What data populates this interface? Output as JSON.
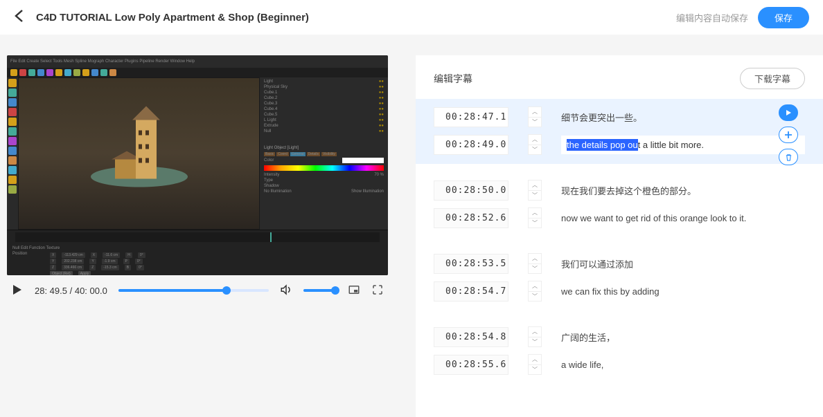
{
  "header": {
    "title": "C4D TUTORIAL Low Poly Apartment & Shop (Beginner)",
    "auto_save": "编辑内容自动保存",
    "save": "保存"
  },
  "player": {
    "current_time": "28: 49.5",
    "duration": "40: 00.0",
    "progress_pct": 71.9,
    "volume_pct": 100
  },
  "subtitle_panel": {
    "title": "编辑字幕",
    "download": "下载字幕"
  },
  "subtitles": [
    {
      "active": true,
      "rows": [
        {
          "ts": "00:28:47.1",
          "text": "细节会更突出一些。",
          "editing": false
        },
        {
          "ts": "00:28:49.0",
          "text_highlight": "the details pop ou",
          "text_rest": "t a little bit more.",
          "editing": true
        }
      ],
      "actions": {
        "play": "play",
        "add": "plus",
        "delete": "trash"
      }
    },
    {
      "active": false,
      "rows": [
        {
          "ts": "00:28:50.0",
          "text": "现在我们要去掉这个橙色的部分。"
        },
        {
          "ts": "00:28:52.6",
          "text": "now we want to get rid of this orange look to it."
        }
      ]
    },
    {
      "active": false,
      "rows": [
        {
          "ts": "00:28:53.5",
          "text": "我们可以通过添加"
        },
        {
          "ts": "00:28:54.7",
          "text": "we can fix this by adding"
        }
      ]
    },
    {
      "active": false,
      "rows": [
        {
          "ts": "00:28:54.8",
          "text": "广阔的生活，"
        },
        {
          "ts": "00:28:55.6",
          "text": "a wide life,"
        }
      ]
    }
  ],
  "c4d": {
    "menu": "File Edit Create Select Tools Mesh Spline Mograph Character Plugins Pipeline Render Window Help",
    "scene_items": [
      "Light",
      "Physical Sky",
      "Cube.1",
      "Cube.2",
      "Cube.3",
      "Cube.4",
      "Cube.5",
      "L Light",
      "Extrude",
      "Null",
      "Null"
    ],
    "attr_tabs": [
      "Basic",
      "Coord",
      "General",
      "Details",
      "Visibility"
    ],
    "bottom_label": "Position",
    "coords": [
      [
        "X",
        "-113.429 cm",
        "X",
        "-11.6 cm",
        "H",
        "0°"
      ],
      [
        "Y",
        "202.238 cm",
        "Y",
        "-1.9 cm",
        "P",
        "0°"
      ],
      [
        "Z",
        "336.466 cm",
        "Z",
        "-15.3 cm",
        "B",
        "0°"
      ]
    ],
    "light_section": "Light Object [Light]",
    "shadow_label": "Shadow",
    "intensity_label": "Intensity",
    "intensity_val": "70 %"
  }
}
